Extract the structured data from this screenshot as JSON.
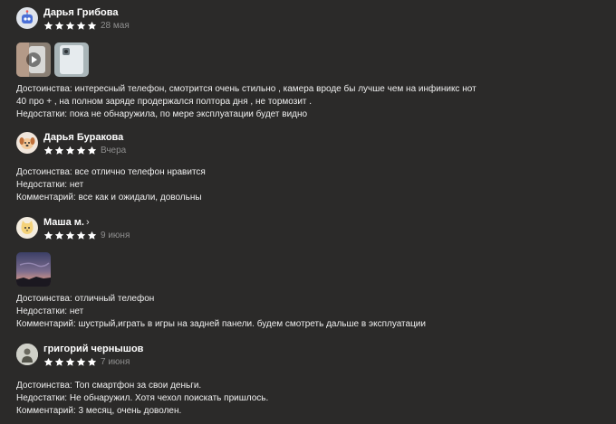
{
  "reviews": [
    {
      "author": "Дарья Грибова",
      "rating": 5,
      "date": "28 мая",
      "avatar_icon": "robot-icon",
      "text_lines": [
        "Достоинства: интересный телефон, смотрится очень стильно , камера вроде бы лучше чем на инфиникс нот",
        "40 про + , на полном заряде продержался полтора дня , не тормозит .",
        "Недостатки: пока не обнаружила, по мере эксплуатации будет видно"
      ]
    },
    {
      "author": "Дарья Буракова",
      "rating": 5,
      "date": "Вчера",
      "avatar_icon": "dog-icon",
      "text_lines": [
        "Достоинства: все отлично телефон нравится",
        "Недостатки: нет",
        "Комментарий: все как и ожидали, довольны"
      ]
    },
    {
      "author": "Маша м.",
      "author_suffix": "›",
      "rating": 5,
      "date": "9 июня",
      "avatar_icon": "cat-icon",
      "text_lines": [
        "Достоинства: отличный телефон",
        "Недостатки: нет",
        "Комментарий: шустрый,играть в игры на задней панели. будем смотреть дальше в эксплуатации"
      ]
    },
    {
      "author": "григорий чернышов",
      "rating": 5,
      "date": "7 июня",
      "avatar_icon": "person-photo-icon",
      "text_lines": [
        "Достоинства: Топ смартфон за свои деньги.",
        "Недостатки: Не обнаружил. Хотя чехол поискать пришлось.",
        "Комментарий: 3 месяц, очень доволен."
      ]
    }
  ],
  "colors": {
    "background": "#2b2a29",
    "star": "#ffffff",
    "date": "#8e8e8e",
    "text": "#efefef"
  }
}
